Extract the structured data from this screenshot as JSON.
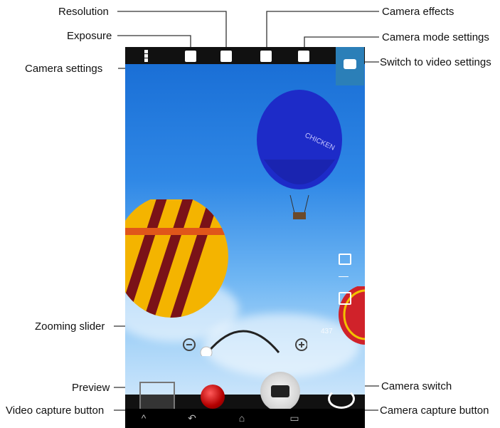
{
  "callouts": {
    "resolution": "Resolution",
    "exposure": "Exposure",
    "camera_settings": "Camera settings",
    "camera_effects": "Camera effects",
    "camera_mode_settings": "Camera mode settings",
    "switch_video": "Switch to video settings",
    "zooming_slider": "Zooming slider",
    "preview": "Preview",
    "video_capture": "Video capture button",
    "camera_switch": "Camera switch",
    "camera_capture": "Camera capture button"
  },
  "screen": {
    "balloon_text_1": "CHICKEN",
    "overlay_number": "437"
  },
  "icons": {
    "camera_settings": "vertical-dots-icon",
    "exposure": "exposure-icon",
    "resolution": "resolution-icon",
    "effects": "effects-icon",
    "mode": "mode-icon",
    "video_switch": "camera-video-switch-icon",
    "zoom_minus": "minus-circle-icon",
    "zoom_plus": "plus-circle-icon",
    "preview": "gallery-preview-icon",
    "video_capture": "record-dot-icon",
    "camera_capture": "camera-icon",
    "camera_switch": "rotate-camera-icon",
    "nav_home": "home-icon",
    "nav_back": "back-icon",
    "nav_recent": "recent-apps-icon",
    "nav_menu": "chevron-up-icon"
  },
  "colors": {
    "accent": "#2b7fb8",
    "record": "#b30000"
  }
}
